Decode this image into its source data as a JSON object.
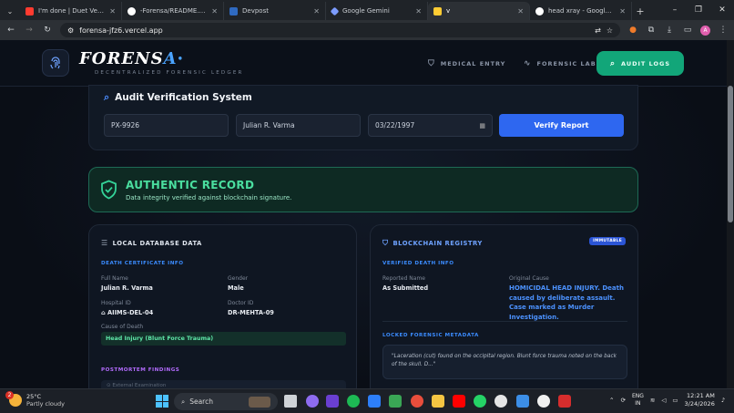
{
  "browser": {
    "tabs": [
      {
        "title": "I'm done | Duet Version | I",
        "icon_color": "#ff3b30",
        "icon": "youtube-icon"
      },
      {
        "title": "-Forensa/README.md at m",
        "icon_color": "#ffffff",
        "icon": "github-icon"
      },
      {
        "title": "Devpost",
        "icon_color": "#2f6ac1",
        "icon": "devpost-icon"
      },
      {
        "title": "Google Gemini",
        "icon_color": "#7c9cff",
        "icon": "gemini-icon"
      },
      {
        "title": "v",
        "icon_color": "#ffcc33",
        "icon": "app-icon"
      },
      {
        "title": "head xray - Google Search",
        "icon_color": "#ffffff",
        "icon": "google-icon"
      }
    ],
    "url": "forensa-jfz6.vercel.app",
    "window_controls": [
      "–",
      "❐",
      "✕"
    ]
  },
  "nav": {
    "brand_main": "FORENS",
    "brand_accent": "A",
    "brand_dot": "•",
    "tagline": "DECENTRALIZED FORENSIC LEDGER",
    "medical_entry": "MEDICAL ENTRY",
    "forensic_lab": "FORENSIC LAB",
    "audit_logs": "AUDIT LOGS"
  },
  "audit": {
    "title": "Audit Verification System",
    "patient_id": "PX-9926",
    "name": "Julian R. Varma",
    "dob": "03/22/1997",
    "verify_label": "Verify Report"
  },
  "authentic": {
    "title": "AUTHENTIC RECORD",
    "subtitle": "Data integrity verified against blockchain signature."
  },
  "local": {
    "header": "LOCAL DATABASE DATA",
    "section": "DEATH CERTIFICATE INFO",
    "full_name_label": "Full Name",
    "full_name": "Julian R. Varma",
    "gender_label": "Gender",
    "gender": "Male",
    "hospital_label": "Hospital ID",
    "hospital": "AIIMS-DEL-04",
    "doctor_label": "Doctor ID",
    "doctor": "DR-MEHTA-09",
    "cause_label": "Cause of Death",
    "cause": "Head Injury (Blunt Force Trauma)",
    "postmortem": "POSTMORTEM FINDINGS",
    "pm_item": "External Examination"
  },
  "chain": {
    "header": "BLOCKCHAIN REGISTRY",
    "badge": "IMMUTABLE",
    "section": "VERIFIED DEATH INFO",
    "reported_label": "Reported Name",
    "reported": "As Submitted",
    "orig_label": "Original Cause",
    "orig_cause": "HOMICIDAL HEAD INJURY. Death caused by deliberate assault. Case marked as Murder Investigation.",
    "meta_header": "LOCKED FORENSIC METADATA",
    "meta_text": "\"Laceration (cut) found on the occipital region. Blunt force trauma noted on the back of the skull. D...\""
  },
  "taskbar": {
    "temp": "25°C",
    "weather": "Partly cloudy",
    "notif": "2",
    "search": "Search",
    "lang1": "ENG",
    "lang2": "IN",
    "time": "12:21 AM",
    "date": "3/24/2026"
  }
}
